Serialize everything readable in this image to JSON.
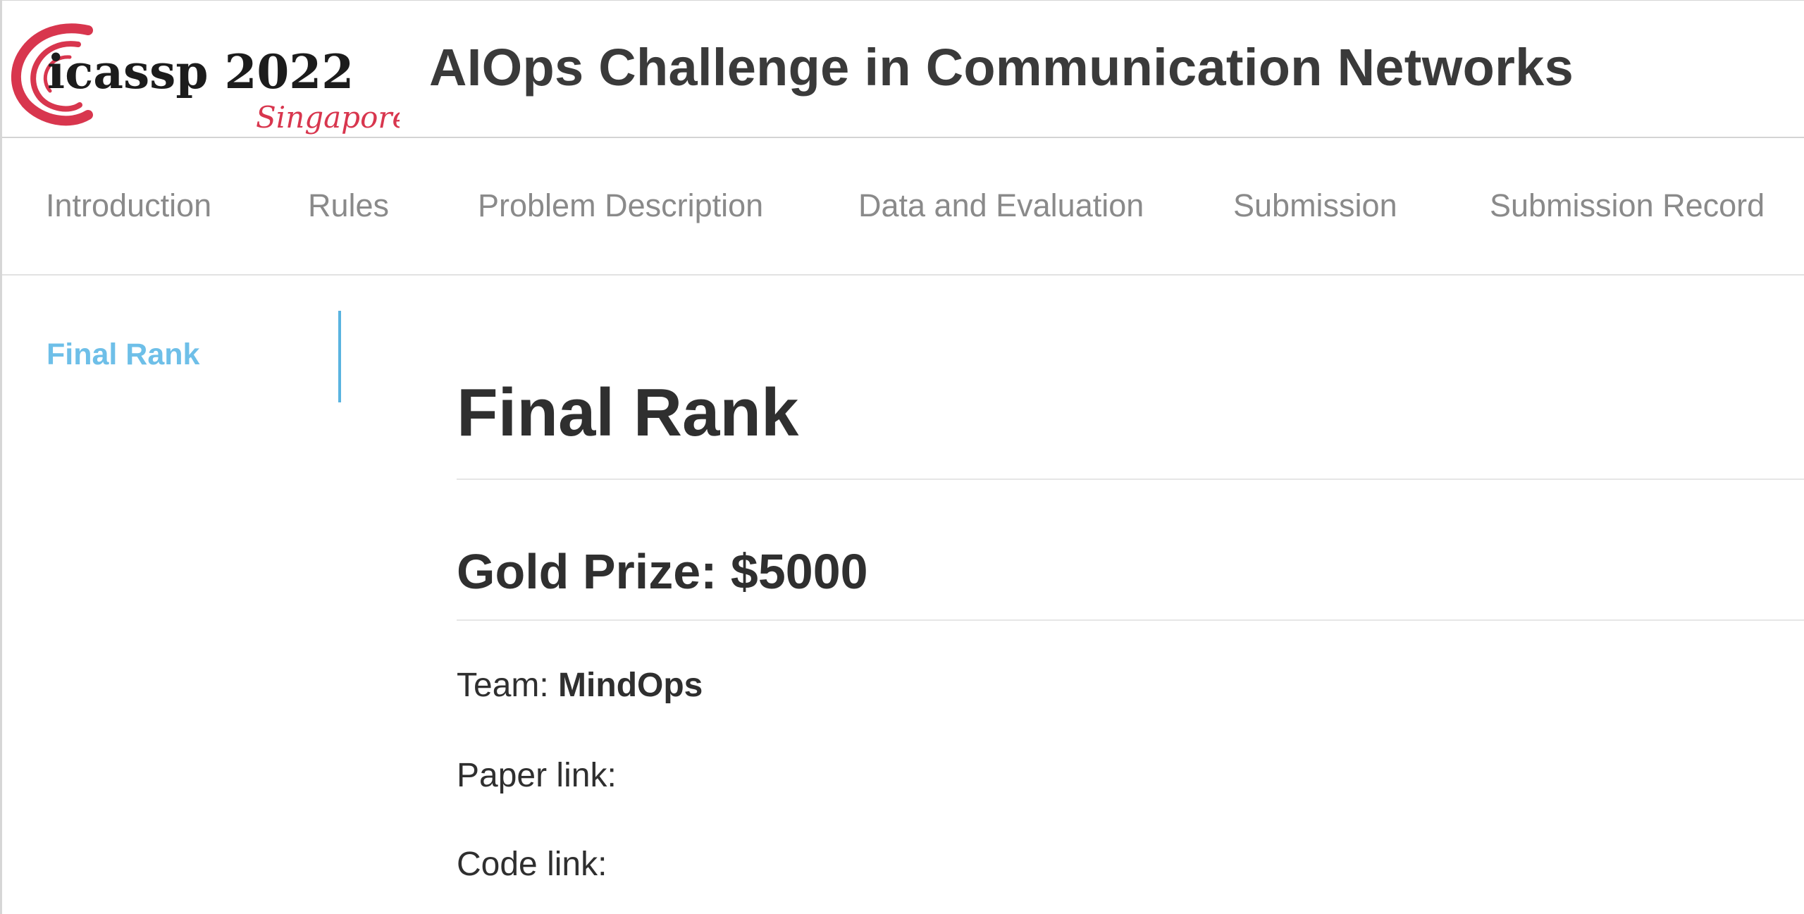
{
  "header": {
    "logo": {
      "wordmark": "icassp 2022",
      "location": "Singapore",
      "brand_color": "#d8364e"
    },
    "title": "AIOps Challenge in Communication Networks"
  },
  "nav": {
    "items": [
      {
        "label": "Introduction"
      },
      {
        "label": "Rules"
      },
      {
        "label": "Problem Description"
      },
      {
        "label": "Data and Evaluation"
      },
      {
        "label": "Submission"
      },
      {
        "label": "Submission Record"
      }
    ]
  },
  "sidebar": {
    "items": [
      {
        "label": "Final Rank",
        "active": true
      }
    ],
    "accent_color": "#6ebfe8"
  },
  "main": {
    "title": "Final Rank",
    "section": {
      "title": "Gold Prize: $5000",
      "team_label": "Team: ",
      "team_value": "MindOps",
      "paper_label": "Paper link:",
      "code_label": "Code link:"
    }
  }
}
